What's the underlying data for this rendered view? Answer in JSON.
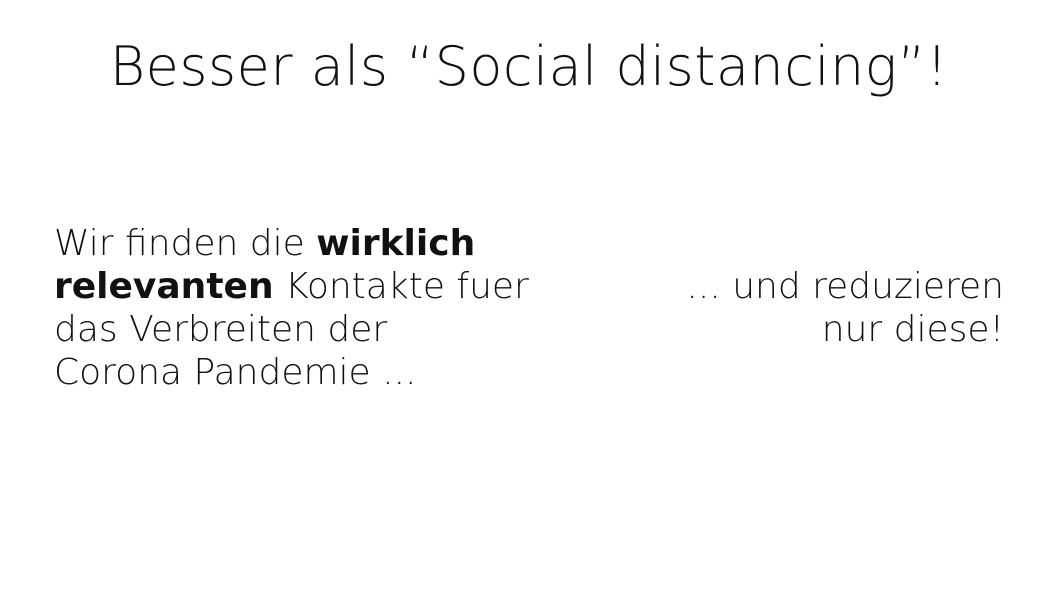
{
  "slide": {
    "title": "Besser als “Social distancing”!",
    "left_text": {
      "line1_plain": "Wir finden die ",
      "line1_bold": "wirklich",
      "line2_bold": "relevanten",
      "line2_plain": " Kontakte fuer",
      "line3": "das Verbreiten der",
      "line4": "Corona Pandemie ..."
    },
    "right_text": {
      "line1": "... und reduzieren",
      "line2": "nur diese!"
    }
  }
}
